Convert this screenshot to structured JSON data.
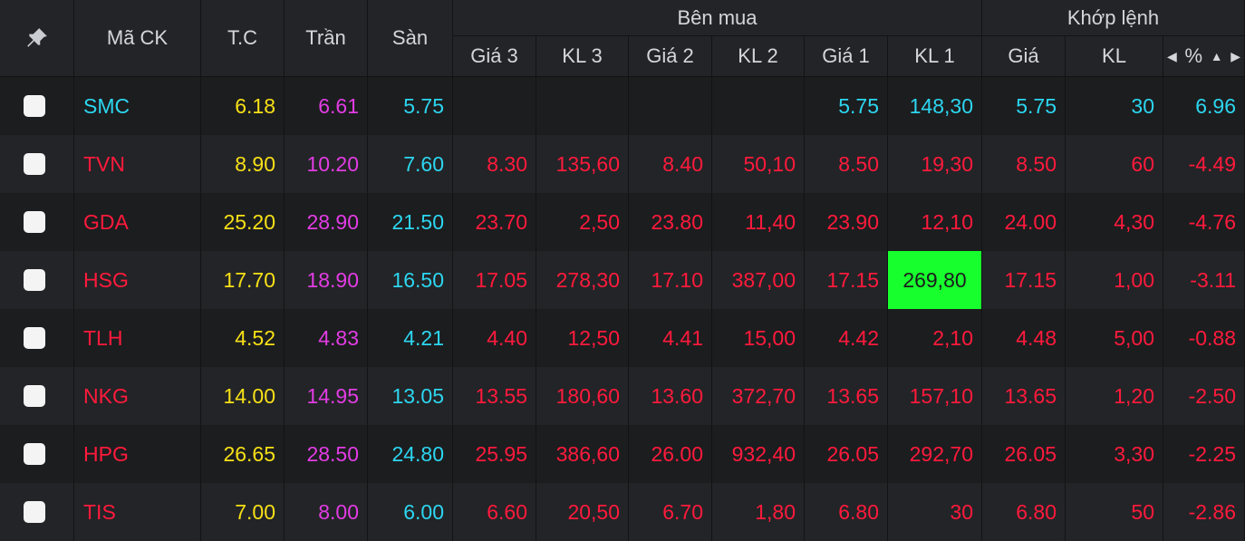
{
  "header": {
    "pin_icon": "pin-icon",
    "symbol": "Mã CK",
    "ref": "T.C",
    "ceiling": "Trần",
    "floor": "Sàn",
    "buy_group": "Bên mua",
    "match_group": "Khớp lệnh",
    "price3": "Giá 3",
    "vol3": "KL 3",
    "price2": "Giá 2",
    "vol2": "KL 2",
    "price1": "Giá 1",
    "vol1": "KL 1",
    "match_price": "Giá",
    "match_vol": "KL",
    "pct": "%",
    "pct_left_icon": "◀",
    "pct_sort_icon": "▲",
    "pct_right_icon": "▶"
  },
  "colors": {
    "ref": "#f7e017",
    "ceiling": "#e23ce4",
    "floor": "#2cd6f0",
    "down": "#ff1a3c",
    "highlight": "#17ff2c"
  },
  "rows": [
    {
      "symbol": "SMC",
      "ref": "6.18",
      "ceiling": "6.61",
      "floor": "5.75",
      "price3": "",
      "vol3": "",
      "price2": "",
      "vol2": "",
      "price1": "5.75",
      "vol1": "148,30",
      "match_price": "5.75",
      "match_vol": "30",
      "pct": "6.96",
      "tone": "cyan"
    },
    {
      "symbol": "TVN",
      "ref": "8.90",
      "ceiling": "10.20",
      "floor": "7.60",
      "price3": "8.30",
      "vol3": "135,60",
      "price2": "8.40",
      "vol2": "50,10",
      "price1": "8.50",
      "vol1": "19,30",
      "match_price": "8.50",
      "match_vol": "60",
      "pct": "-4.49",
      "tone": "down"
    },
    {
      "symbol": "GDA",
      "ref": "25.20",
      "ceiling": "28.90",
      "floor": "21.50",
      "price3": "23.70",
      "vol3": "2,50",
      "price2": "23.80",
      "vol2": "11,40",
      "price1": "23.90",
      "vol1": "12,10",
      "match_price": "24.00",
      "match_vol": "4,30",
      "pct": "-4.76",
      "tone": "down"
    },
    {
      "symbol": "HSG",
      "ref": "17.70",
      "ceiling": "18.90",
      "floor": "16.50",
      "price3": "17.05",
      "vol3": "278,30",
      "price2": "17.10",
      "vol2": "387,00",
      "price1": "17.15",
      "vol1": "269,80",
      "match_price": "17.15",
      "match_vol": "1,00",
      "pct": "-3.11",
      "tone": "down"
    },
    {
      "symbol": "TLH",
      "ref": "4.52",
      "ceiling": "4.83",
      "floor": "4.21",
      "price3": "4.40",
      "vol3": "12,50",
      "price2": "4.41",
      "vol2": "15,00",
      "price1": "4.42",
      "vol1": "2,10",
      "match_price": "4.48",
      "match_vol": "5,00",
      "pct": "-0.88",
      "tone": "down"
    },
    {
      "symbol": "NKG",
      "ref": "14.00",
      "ceiling": "14.95",
      "floor": "13.05",
      "price3": "13.55",
      "vol3": "180,60",
      "price2": "13.60",
      "vol2": "372,70",
      "price1": "13.65",
      "vol1": "157,10",
      "match_price": "13.65",
      "match_vol": "1,20",
      "pct": "-2.50",
      "tone": "down"
    },
    {
      "symbol": "HPG",
      "ref": "26.65",
      "ceiling": "28.50",
      "floor": "24.80",
      "price3": "25.95",
      "vol3": "386,60",
      "price2": "26.00",
      "vol2": "932,40",
      "price1": "26.05",
      "vol1": "292,70",
      "match_price": "26.05",
      "match_vol": "3,30",
      "pct": "-2.25",
      "tone": "down"
    },
    {
      "symbol": "TIS",
      "ref": "7.00",
      "ceiling": "8.00",
      "floor": "6.00",
      "price3": "6.60",
      "vol3": "20,50",
      "price2": "6.70",
      "vol2": "1,80",
      "price1": "6.80",
      "vol1": "30",
      "match_price": "6.80",
      "match_vol": "50",
      "pct": "-2.86",
      "tone": "down"
    }
  ],
  "highlighted_cell": {
    "symbol": "HSG",
    "field": "vol1"
  }
}
